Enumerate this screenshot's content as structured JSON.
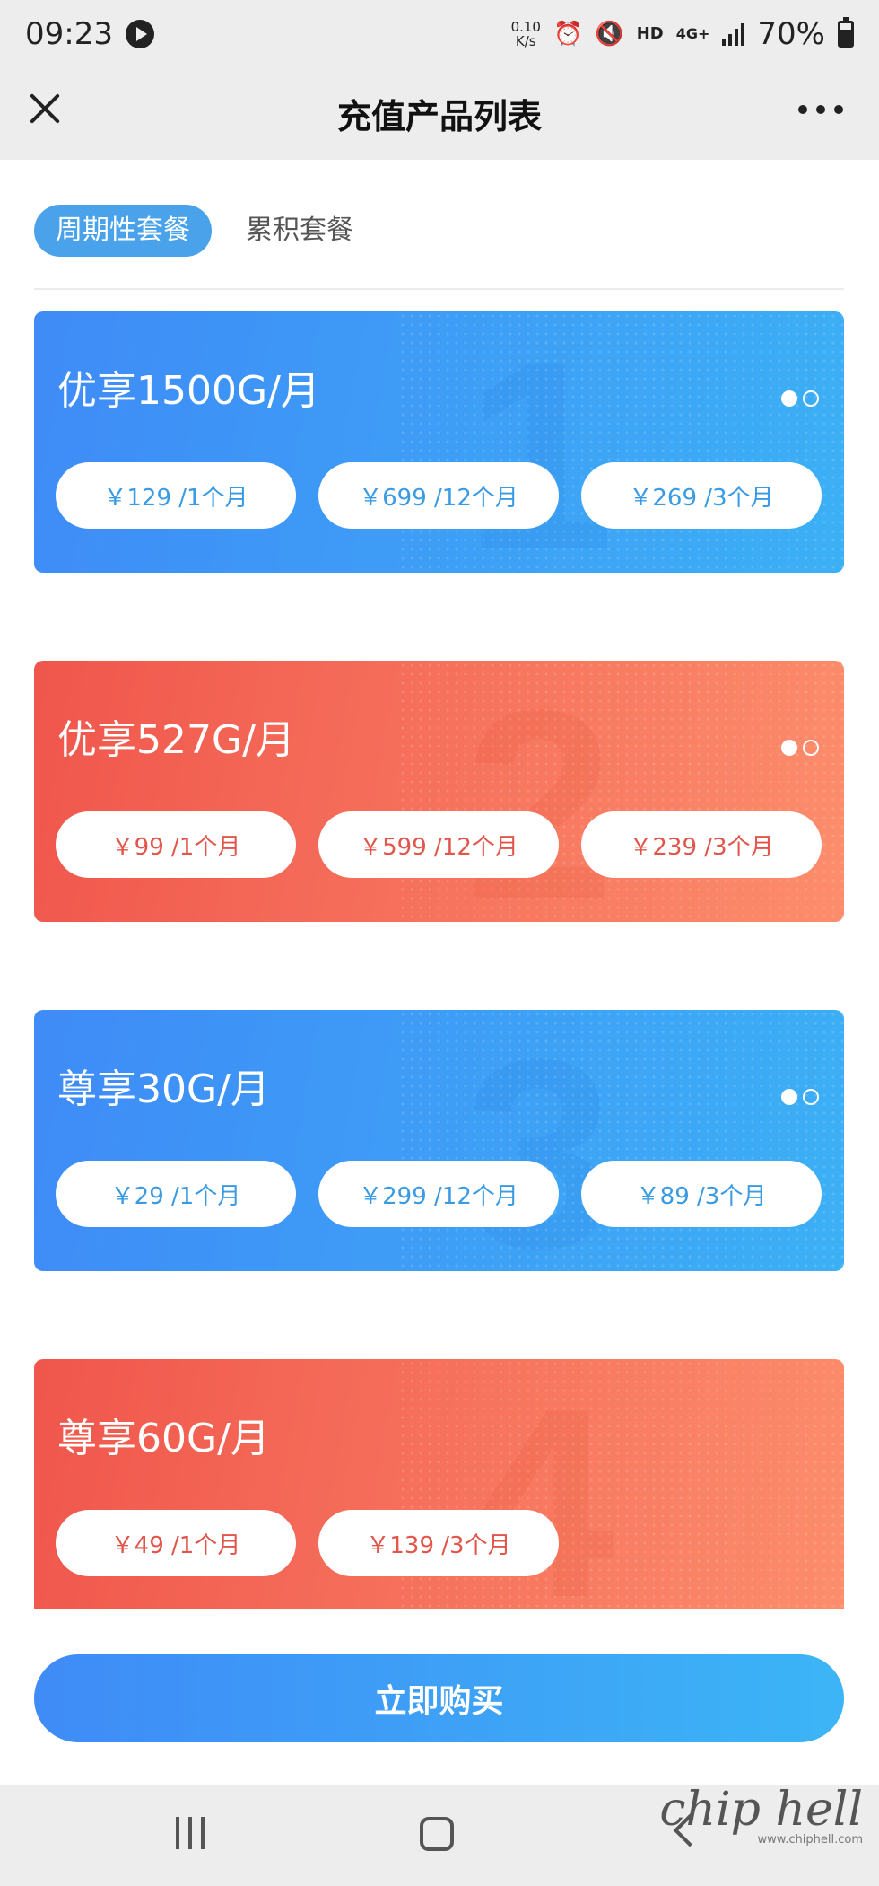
{
  "status_bar": {
    "time": "09:23",
    "net_speed_value": "0.10",
    "net_speed_unit": "K/s",
    "hd_label": "HD",
    "network_label": "4G+",
    "battery": "70%"
  },
  "nav": {
    "title": "充值产品列表"
  },
  "tabs": [
    {
      "label": "周期性套餐",
      "active": true
    },
    {
      "label": "累积套餐",
      "active": false
    }
  ],
  "cards": [
    {
      "index": "1",
      "title": "优享1500G/月",
      "theme": "blue",
      "prices": [
        "￥129 /1个月",
        "￥699 /12个月",
        "￥269 /3个月"
      ]
    },
    {
      "index": "2",
      "title": "优享527G/月",
      "theme": "orange",
      "prices": [
        "￥99 /1个月",
        "￥599 /12个月",
        "￥239 /3个月"
      ]
    },
    {
      "index": "3",
      "title": "尊享30G/月",
      "theme": "blue",
      "prices": [
        "￥29 /1个月",
        "￥299 /12个月",
        "￥89 /3个月"
      ]
    },
    {
      "index": "4",
      "title": "尊享60G/月",
      "theme": "orange",
      "prices": [
        "￥49 /1个月",
        "￥139 /3个月"
      ]
    }
  ],
  "buy_button": {
    "label": "立即购买"
  },
  "watermark": {
    "logo": "chip hell",
    "url": "www.chiphell.com"
  },
  "colors": {
    "blue_start": "#3f8bf7",
    "blue_end": "#3cb0f5",
    "orange_start": "#f0564c",
    "orange_end": "#fc8d6c",
    "tab_active": "#4aa3ea"
  }
}
